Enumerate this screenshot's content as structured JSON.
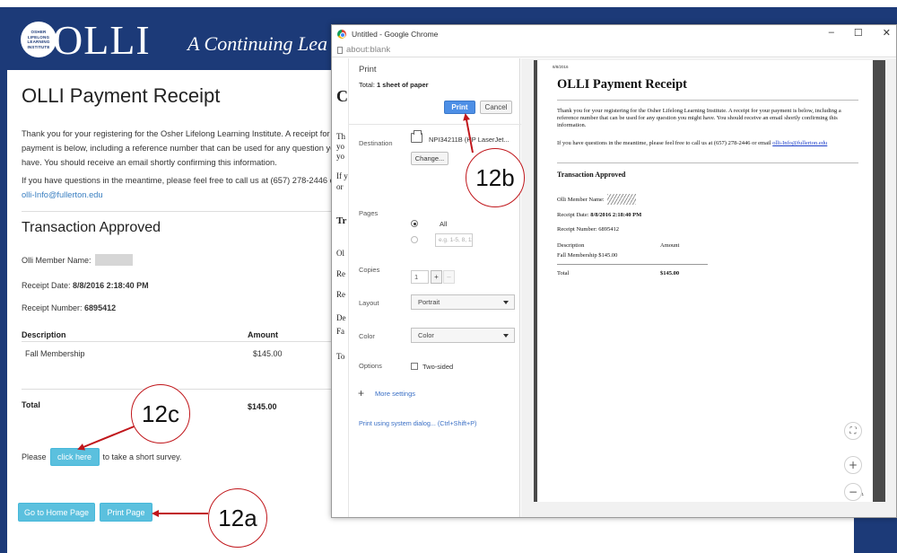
{
  "olli": {
    "logo_small": [
      "OSHER",
      "LIFELONG",
      "LEARNING",
      "INSTITUTE"
    ],
    "logo_text": "OLLI",
    "tagline": "A Continuing Lea",
    "page_title": "OLLI Payment Receipt",
    "intro": "Thank you for your registering for the Osher Lifelong Learning Institute. A receipt for your payment is below, including a reference number that can be used for any question you might have. You should receive an email shortly confirming this information.",
    "contact_prefix": "If you have questions in the meantime, please feel free to call us at (657) 278-2446 or email ",
    "contact_email": "olli-Info@fullerton.edu",
    "transaction_title": "Transaction Approved",
    "member_label": "Olli Member Name:",
    "receipt_date_label": "Receipt Date:",
    "receipt_date_value": "8/8/2016 2:18:40 PM",
    "receipt_number_label": "Receipt Number:",
    "receipt_number_value": "6895412",
    "col_description": "Description",
    "col_amount": "Amount",
    "item_description": "Fall Membership",
    "item_amount": "$145.00",
    "total_label": "Total",
    "total_amount": "$145.00",
    "survey_prefix": "Please",
    "survey_button": "click here",
    "survey_suffix": "to take a short survey.",
    "home_button": "Go to Home Page",
    "print_button": "Print Page"
  },
  "chrome": {
    "window_title": "Untitled - Google Chrome",
    "address": "about:blank",
    "controls": [
      "–",
      "☐",
      "✕"
    ],
    "bg_letters": [
      "C",
      "Th",
      "yo",
      "yo",
      "If y",
      "or",
      "Tr",
      "Ol",
      "Re",
      "Re",
      "De",
      "Fa",
      "To"
    ]
  },
  "print_dialog": {
    "title": "Print",
    "total_prefix": "Total: ",
    "total_value": "1 sheet of paper",
    "print_button": "Print",
    "cancel_button": "Cancel",
    "destination_label": "Destination",
    "destination_value": "NPI34211B (HP LaserJet...",
    "change_button": "Change...",
    "pages_label": "Pages",
    "pages_all": "All",
    "pages_range_placeholder": "e.g. 1-5, 8, 11-13",
    "copies_label": "Copies",
    "copies_value": "1",
    "copies_plus": "+",
    "copies_minus": "–",
    "layout_label": "Layout",
    "layout_value": "Portrait",
    "color_label": "Color",
    "color_value": "Color",
    "options_label": "Options",
    "two_sided_label": "Two-sided",
    "more_settings": "More settings",
    "system_dialog": "Print using system dialog... (Ctrl+Shift+P)"
  },
  "preview": {
    "date": "8/8/2016",
    "title": "OLLI Payment Receipt",
    "intro": "Thank you for your registering for the Osher Lifelong Learning Institute. A receipt for your payment is below, including a reference number that can be used for any question you might have. You should receive an email shortly confirming this information.",
    "contact_prefix": "If you have questions in the meantime, please feel free to call us at (657) 278-2446 or email ",
    "contact_email": "olli-Info@fullerton.edu",
    "transaction_title": "Transaction Approved",
    "member_label": "Olli Member Name:",
    "receipt_date_label": "Receipt Date:",
    "receipt_date_value": "8/8/2016 2:18:40 PM",
    "receipt_number": "Receipt Number: 6895412",
    "col_description": "Description",
    "col_amount": "Amount",
    "item": "Fall Membership $145.00",
    "total_label": "Total",
    "total_amount": "$145.00",
    "page_number": "1/1",
    "zoom_fit": "⛶",
    "zoom_in": "+",
    "zoom_out": "−"
  },
  "annotations": {
    "step_a": "12a",
    "step_b": "12b",
    "step_c": "12c",
    "color": "#c0161b"
  }
}
